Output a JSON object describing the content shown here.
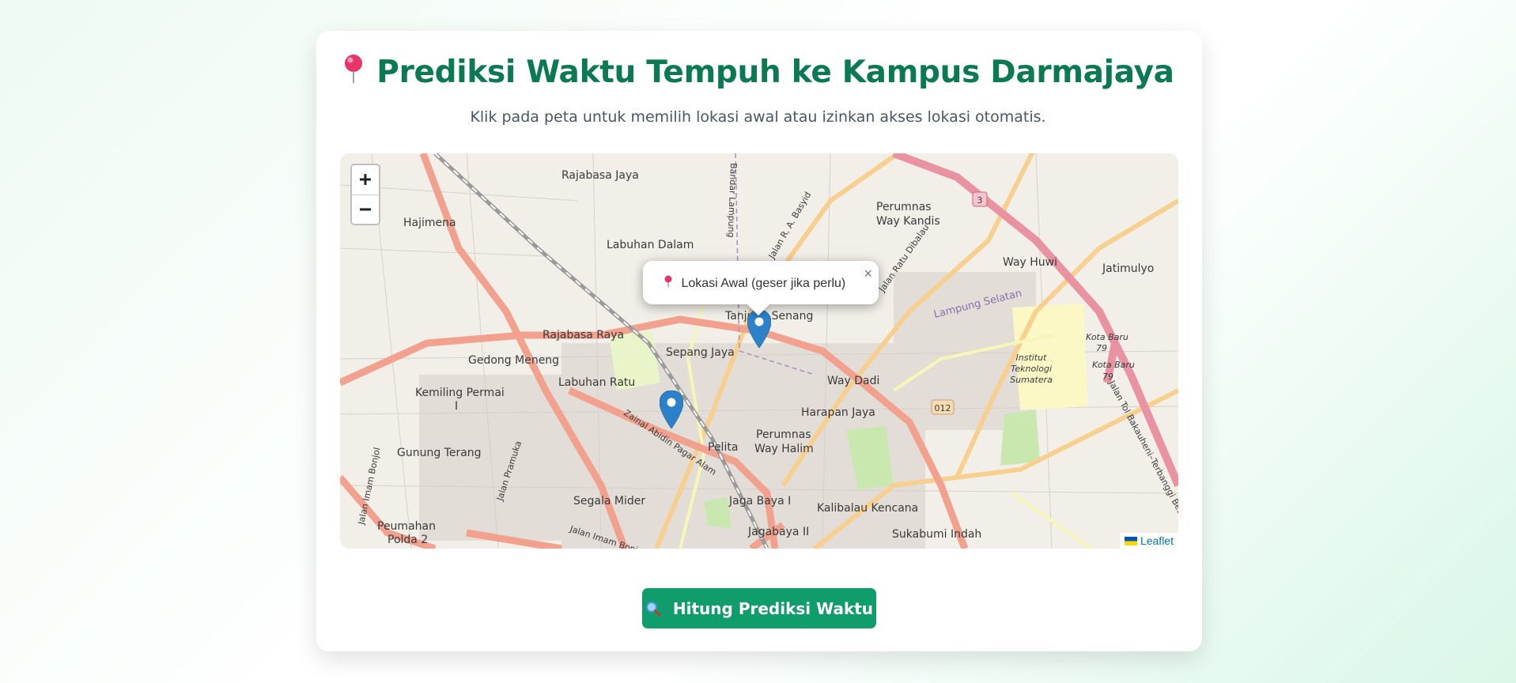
{
  "header": {
    "title": "Prediksi Waktu Tempuh ke Kampus Darmajaya",
    "title_icon": "round-pushpin-icon",
    "subtitle": "Klik pada peta untuk memilih lokasi awal atau izinkan akses lokasi otomatis."
  },
  "map": {
    "zoom_in_label": "+",
    "zoom_out_label": "−",
    "popup_text": "Lokasi Awal (geser jika perlu)",
    "popup_close": "×",
    "attribution": "Leaflet",
    "markers": [
      "start-location-marker",
      "campus-marker"
    ],
    "place_labels": [
      "Rajabasa Jaya",
      "Hajimena",
      "Labuhan Dalam",
      "Perumnas",
      "Way Kandis",
      "Way Huwi",
      "Jatimulyo",
      "Tanjung Senang",
      "Rajabasa Raya",
      "Gedong Meneng",
      "Sepang Jaya",
      "Labuhan Ratu",
      "Kemiling Permai",
      "I",
      "Way Dadi",
      "Harapan Jaya",
      "Institut",
      "Teknologi",
      "Sumatera",
      "Gunung Terang",
      "Pelita",
      "Perumnas",
      "Way Halim",
      "Segala Mider",
      "Jaga Baya I",
      "Kalibalau Kencana",
      "Peumahan",
      "Polda 2",
      "Jagabaya II",
      "Sukabumi Indah",
      "Kota Baru",
      "79",
      "Kota Baru",
      "79"
    ],
    "road_labels": [
      "Bandar Lampung",
      "Jalan R. A. Basyid",
      "Jalan Ratu Dibalau",
      "Lampung Selatan",
      "Zainal Abidin Pagar Alam",
      "Jalan Pramuka",
      "Jalan Imam Bonjol",
      "Jalan Imam Bonjol",
      "Jalan Tol Bakauheni–Terbanggi Besar",
      "3",
      "012"
    ],
    "colors": {
      "primary_road": "#f2a18e",
      "secondary_road": "#f7cf8f",
      "tertiary_road": "#f6f6b9",
      "motorway": "#e892a2",
      "park": "#c9e8b0",
      "marker": "#2b82cb"
    }
  },
  "action": {
    "button_label": "Hitung Prediksi Waktu",
    "button_icon": "magnifier-icon",
    "button_color": "#0f9d6b"
  }
}
